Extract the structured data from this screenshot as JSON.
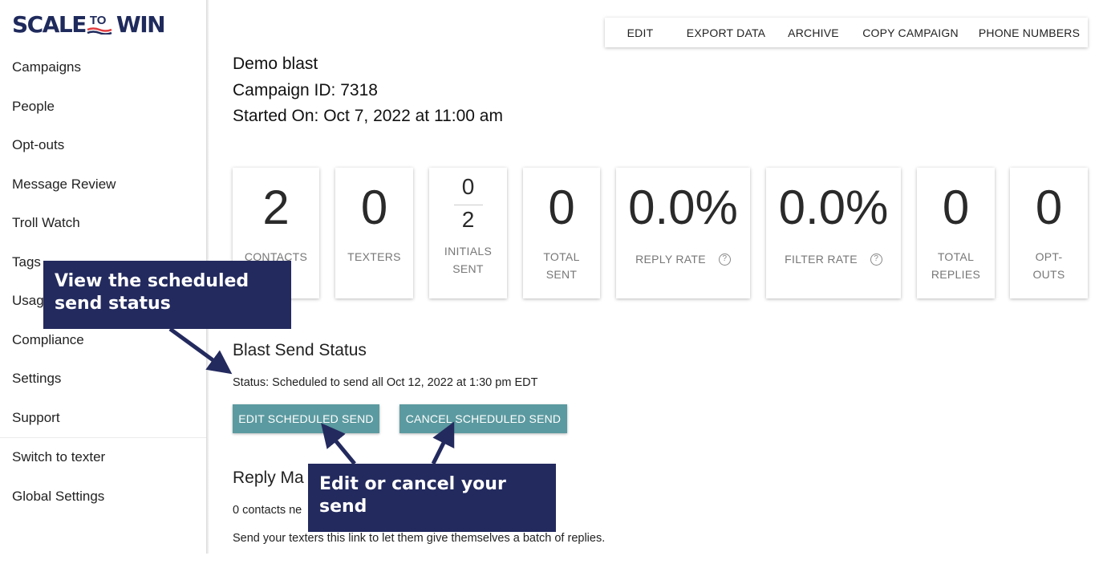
{
  "brand": {
    "logo_left": "SCALE",
    "logo_mid": "TO",
    "logo_right": "WIN",
    "colors": {
      "navy": "#1f2a5c",
      "red": "#e03a3e",
      "teal": "#5b9aa0",
      "callout": "#232a5e"
    }
  },
  "sidebar": {
    "items": [
      {
        "label": "Campaigns"
      },
      {
        "label": "People"
      },
      {
        "label": "Opt-outs"
      },
      {
        "label": "Message Review"
      },
      {
        "label": "Troll Watch"
      },
      {
        "label": "Tags"
      },
      {
        "label": "Usage"
      },
      {
        "label": "Compliance"
      },
      {
        "label": "Settings"
      },
      {
        "label": "Support"
      },
      {
        "label": "Switch to texter"
      },
      {
        "label": "Global Settings"
      }
    ]
  },
  "toolbar": {
    "edit": "EDIT",
    "export": "EXPORT DATA",
    "archive": "ARCHIVE",
    "copy": "COPY CAMPAIGN",
    "phone": "PHONE NUMBERS"
  },
  "campaign": {
    "name": "Demo blast",
    "id_line": "Campaign ID: 7318",
    "started_line": "Started On: Oct 7, 2022 at 11:00 am"
  },
  "stats": {
    "contacts": {
      "value": "2",
      "label": "CONTACTS"
    },
    "texters": {
      "value": "0",
      "label": "TEXTERS"
    },
    "initials": {
      "sent": "0",
      "total": "2",
      "label_line1": "INITIALS",
      "label_line2": "SENT"
    },
    "total_sent": {
      "value": "0",
      "label_line1": "TOTAL",
      "label_line2": "SENT"
    },
    "reply_rate": {
      "value": "0.0%",
      "label": "REPLY RATE",
      "help_icon": "question-circle-icon"
    },
    "filter_rate": {
      "value": "0.0%",
      "label": "FILTER RATE",
      "help_icon": "question-circle-icon"
    },
    "total_replies": {
      "value": "0",
      "label_line1": "TOTAL",
      "label_line2": "REPLIES"
    },
    "opt_outs": {
      "value": "0",
      "label_line1": "OPT-",
      "label_line2": "OUTS"
    }
  },
  "blast": {
    "title": "Blast Send Status",
    "status": "Status: Scheduled to send all Oct 12, 2022 at 1:30 pm EDT",
    "edit_button": "EDIT SCHEDULED SEND",
    "cancel_button": "CANCEL SCHEDULED SEND"
  },
  "reply": {
    "title": "Reply Ma",
    "contacts_text": "0 contacts ne",
    "link_text": "Send your texters this link to let them give themselves a batch of replies."
  },
  "callouts": {
    "status_callout_line1": "View the scheduled",
    "status_callout_line2": "send status",
    "edit_callout_line1": "Edit or cancel your",
    "edit_callout_line2": "send"
  }
}
